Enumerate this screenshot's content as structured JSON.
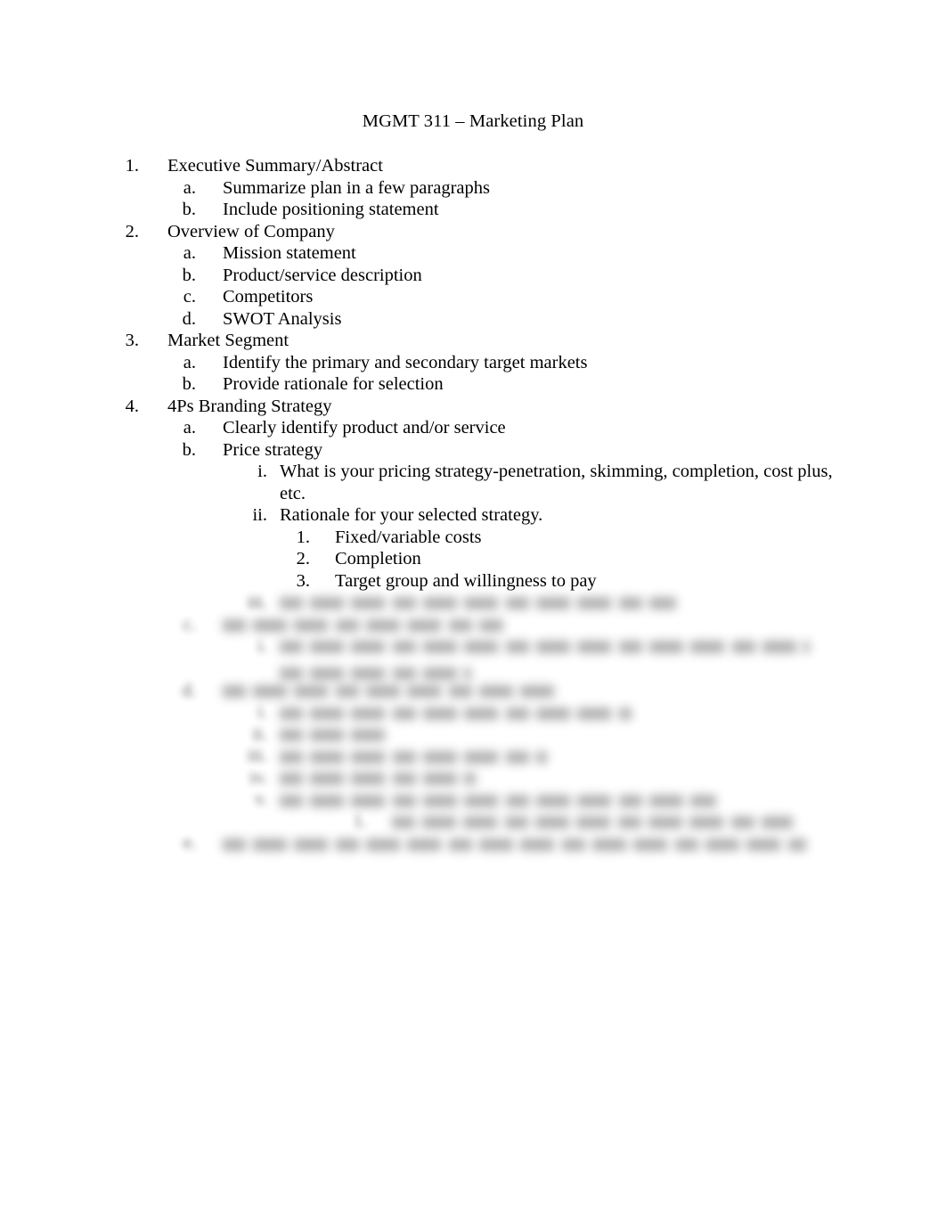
{
  "document": {
    "title": "MGMT 311 – Marketing Plan",
    "background_color": "#ffffff",
    "text_color": "#000000",
    "page_size": "1062x1377"
  },
  "outline": {
    "items": [
      {
        "marker": "1.",
        "level": 1,
        "text": "Executive Summary/Abstract",
        "blurred": false
      },
      {
        "marker": "a.",
        "level": 2,
        "text": "Summarize plan in a few paragraphs",
        "blurred": false
      },
      {
        "marker": "b.",
        "level": 2,
        "text": "Include positioning statement",
        "blurred": false
      },
      {
        "marker": "2.",
        "level": 1,
        "text": "Overview of Company",
        "blurred": false
      },
      {
        "marker": "a.",
        "level": 2,
        "text": "Mission statement",
        "blurred": false
      },
      {
        "marker": "b.",
        "level": 2,
        "text": "Product/service description",
        "blurred": false
      },
      {
        "marker": "c.",
        "level": 2,
        "text": "Competitors",
        "blurred": false
      },
      {
        "marker": "d.",
        "level": 2,
        "text": "SWOT Analysis",
        "blurred": false
      },
      {
        "marker": "3.",
        "level": 1,
        "text": "Market Segment",
        "blurred": false
      },
      {
        "marker": "a.",
        "level": 2,
        "text": "Identify the primary and secondary target markets",
        "blurred": false
      },
      {
        "marker": "b.",
        "level": 2,
        "text": "Provide rationale for selection",
        "blurred": false
      },
      {
        "marker": "4.",
        "level": 1,
        "text": "4Ps Branding Strategy",
        "blurred": false
      },
      {
        "marker": "a.",
        "level": 2,
        "text": "Clearly identify product and/or service",
        "blurred": false
      },
      {
        "marker": "b.",
        "level": 2,
        "text": "Price strategy",
        "blurred": false
      },
      {
        "marker": "i.",
        "level": 3,
        "text": "What is your pricing strategy-penetration, skimming, completion, cost plus, etc.",
        "blurred": false
      },
      {
        "marker": "ii.",
        "level": 3,
        "text": "Rationale for your selected strategy.",
        "blurred": false
      },
      {
        "marker": "1.",
        "level": 4,
        "text": "Fixed/variable costs",
        "blurred": false
      },
      {
        "marker": "2.",
        "level": 4,
        "text": "Completion",
        "blurred": false
      },
      {
        "marker": "3.",
        "level": 4,
        "text": "Target group and willingness to pay",
        "blurred": false
      },
      {
        "marker": "iii.",
        "level": 3,
        "text": "",
        "blurred": true,
        "marker_visible": true,
        "blur_width": 445
      },
      {
        "marker": "c.",
        "level": 2,
        "text": "",
        "blurred": true,
        "marker_visible": false,
        "blur_width": 315
      },
      {
        "marker": "i.",
        "level": 3,
        "text": "",
        "blurred": true,
        "marker_visible": false,
        "blur_width": 595,
        "blur_width_2": 215
      },
      {
        "marker": "d.",
        "level": 2,
        "text": "",
        "blurred": true,
        "marker_visible": false,
        "blur_width": 375
      },
      {
        "marker": "i.",
        "level": 3,
        "text": "",
        "blurred": true,
        "marker_visible": false,
        "blur_width": 395
      },
      {
        "marker": "ii.",
        "level": 3,
        "text": "",
        "blurred": true,
        "marker_visible": false,
        "blur_width": 120
      },
      {
        "marker": "iii.",
        "level": 3,
        "text": "",
        "blurred": true,
        "marker_visible": false,
        "blur_width": 300
      },
      {
        "marker": "iv.",
        "level": 3,
        "text": "",
        "blurred": true,
        "marker_visible": false,
        "blur_width": 220
      },
      {
        "marker": "v.",
        "level": 3,
        "text": "",
        "blurred": true,
        "marker_visible": false,
        "blur_width": 490
      },
      {
        "marker": "1.",
        "level": 5,
        "text": "",
        "blurred": true,
        "marker_visible": false,
        "blur_width": 450
      },
      {
        "marker": "e.",
        "level": 2,
        "text": "",
        "blurred": true,
        "marker_visible": false,
        "blur_width": 655
      }
    ]
  }
}
